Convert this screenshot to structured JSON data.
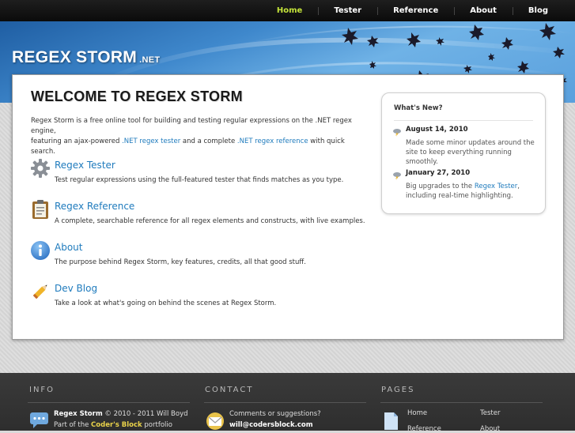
{
  "nav": {
    "items": [
      {
        "label": "Home",
        "active": true
      },
      {
        "label": "Tester",
        "active": false
      },
      {
        "label": "Reference",
        "active": false
      },
      {
        "label": "About",
        "active": false
      },
      {
        "label": "Blog",
        "active": false
      }
    ]
  },
  "brand": {
    "name": "REGEX STORM",
    "tld": ".NET"
  },
  "main": {
    "heading": "WELCOME TO REGEX STORM",
    "intro_part1": "Regex Storm is a free online tool for building and testing regular expressions on the .NET regex engine,",
    "intro_part2": "featuring an ajax-powered ",
    "intro_link1": ".NET regex tester",
    "intro_part3": " and a complete ",
    "intro_link2": ".NET regex reference",
    "intro_part4": " with quick search.",
    "features": [
      {
        "title": "Regex Tester",
        "desc": "Test regular expressions using the full-featured tester that finds matches as you type.",
        "icon": "gear-icon"
      },
      {
        "title": "Regex Reference",
        "desc": "A complete, searchable reference for all regex elements and constructs, with live examples.",
        "icon": "clipboard-icon"
      },
      {
        "title": "About",
        "desc": "The purpose behind Regex Storm, key features, credits, all that good stuff.",
        "icon": "info-icon"
      },
      {
        "title": "Dev Blog",
        "desc": "Take a look at what's going on behind the scenes at Regex Storm.",
        "icon": "pencil-icon"
      }
    ]
  },
  "news": {
    "title": "What's New?",
    "items": [
      {
        "date": "August 14, 2010",
        "text": "Made some minor updates around the site to keep everything running smoothly."
      },
      {
        "date": "January 27, 2010",
        "text_before": "Big upgrades to the ",
        "link": "Regex Tester",
        "text_after": ", including real-time highlighting."
      }
    ]
  },
  "footer": {
    "info": {
      "heading": "INFO",
      "name": "Regex Storm",
      "copyright": " © 2010 - 2011 Will Boyd",
      "part_of": "Part of the ",
      "coders_block": "Coder's Block",
      "portfolio": " portfolio"
    },
    "contact": {
      "heading": "CONTACT",
      "prompt": "Comments or suggestions?",
      "email": "will@codersblock.com"
    },
    "pages": {
      "heading": "PAGES",
      "links": [
        "Home",
        "Tester",
        "Reference",
        "About"
      ]
    }
  },
  "colors": {
    "accent_link": "#1f7bbd",
    "nav_active": "#c4e33a",
    "footer_highlight": "#e9d24a"
  }
}
